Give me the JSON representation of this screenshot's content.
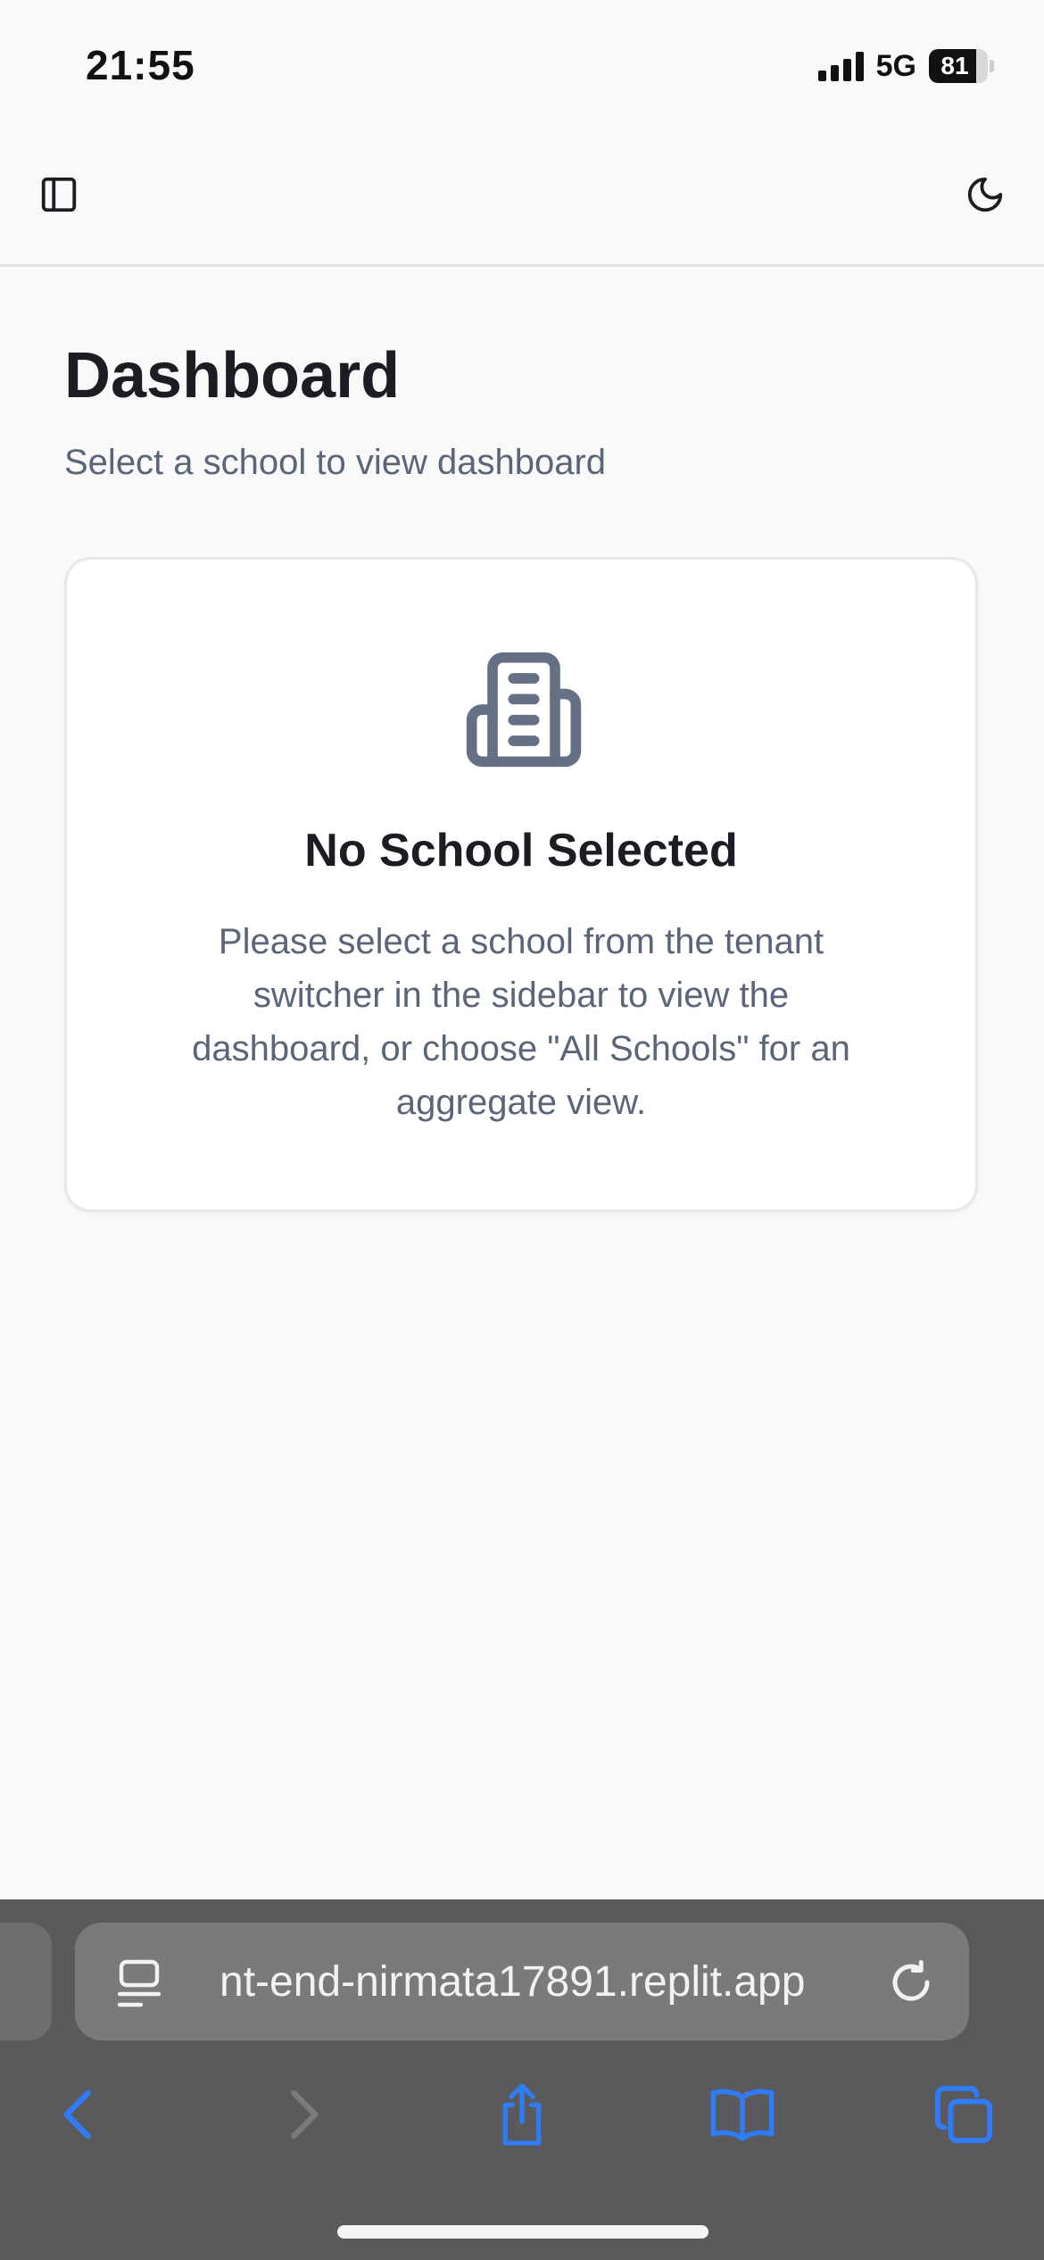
{
  "status_bar": {
    "time": "21:55",
    "network": "5G",
    "battery": "81",
    "battery_level": 0.81
  },
  "app_bar": {
    "left_icon": "sidebar-toggle-icon",
    "right_icon": "moon-icon"
  },
  "page": {
    "title": "Dashboard",
    "subtitle": "Select a school to view dashboard"
  },
  "empty_state": {
    "icon": "building-icon",
    "title": "No School Selected",
    "message": "Please select a school from the tenant switcher in the sidebar to view the dashboard, or choose \"All Schools\" for an aggregate view."
  },
  "browser": {
    "url": "nt-end-nirmata17891.replit.app",
    "accent": "#2f7cf6",
    "toolbar": {
      "back_icon": "chevron-left-icon",
      "forward_icon": "chevron-right-icon",
      "share_icon": "share-icon",
      "bookmarks_icon": "book-icon",
      "tabs_icon": "tabs-icon"
    }
  }
}
